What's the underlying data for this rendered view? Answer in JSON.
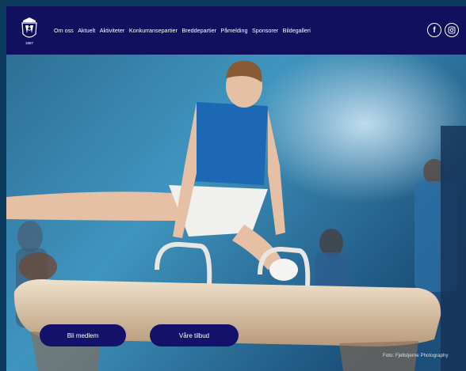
{
  "nav": {
    "items": [
      "Om oss",
      "Aktuelt",
      "Aktiviteter",
      "Konkurransepartier",
      "Breddepartier",
      "Påmelding",
      "Sponsorer",
      "Bildegalleri"
    ],
    "logo_year": "1887",
    "social": {
      "facebook_glyph": "f",
      "instagram_icon": "instagram-icon"
    }
  },
  "hero": {
    "primary_button": "Bli medlem",
    "secondary_button": "Våre tilbud",
    "photo_credit": "Foto: Fjellstjerne Photography"
  },
  "colors": {
    "nav_bg": "#11105e",
    "button_bg": "#14116a"
  }
}
